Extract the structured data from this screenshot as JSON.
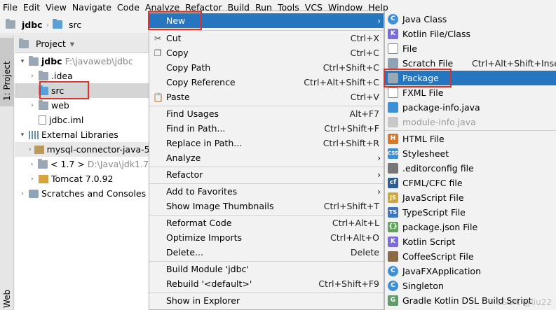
{
  "menubar": [
    "File",
    "Edit",
    "View",
    "Navigate",
    "Code",
    "Analyze",
    "Refactor",
    "Build",
    "Run",
    "Tools",
    "VCS",
    "Window",
    "Help"
  ],
  "breadcrumb": [
    "jdbc",
    "src"
  ],
  "stripe": {
    "project_tab": "1: Project",
    "web_tab": "Web"
  },
  "project_panel": {
    "title": "Project",
    "dropdown": "▾"
  },
  "tree": [
    {
      "arrow": "▾",
      "label": "jdbc",
      "hint": "F:\\javaweb\\jdbc"
    },
    {
      "arrow": "›",
      "label": ".idea"
    },
    {
      "arrow": "",
      "label": "src"
    },
    {
      "arrow": "›",
      "label": "web"
    },
    {
      "arrow": "",
      "label": "jdbc.iml"
    },
    {
      "arrow": "▾",
      "label": "External Libraries"
    },
    {
      "arrow": "›",
      "label": "mysql-connector-java-5"
    },
    {
      "arrow": "›",
      "label": "< 1.7 >",
      "hint": "D:\\Java\\jdk1.7"
    },
    {
      "arrow": "›",
      "label": "Tomcat 7.0.92"
    },
    {
      "arrow": "›",
      "label": "Scratches and Consoles"
    }
  ],
  "context_menu": {
    "new": "New",
    "cut": {
      "label": "Cut",
      "shortcut": "Ctrl+X"
    },
    "copy": {
      "label": "Copy",
      "shortcut": "Ctrl+C"
    },
    "copy_path": {
      "label": "Copy Path",
      "shortcut": "Ctrl+Shift+C"
    },
    "copy_reference": {
      "label": "Copy Reference",
      "shortcut": "Ctrl+Alt+Shift+C"
    },
    "paste": {
      "label": "Paste",
      "shortcut": "Ctrl+V"
    },
    "find_usages": {
      "label": "Find Usages",
      "shortcut": "Alt+F7"
    },
    "find_in_path": {
      "label": "Find in Path...",
      "shortcut": "Ctrl+Shift+F"
    },
    "replace_in_path": {
      "label": "Replace in Path...",
      "shortcut": "Ctrl+Shift+R"
    },
    "analyze": "Analyze",
    "refactor": "Refactor",
    "add_to_favorites": "Add to Favorites",
    "show_image_thumbnails": {
      "label": "Show Image Thumbnails",
      "shortcut": "Ctrl+Shift+T"
    },
    "reformat_code": {
      "label": "Reformat Code",
      "shortcut": "Ctrl+Alt+L"
    },
    "optimize_imports": {
      "label": "Optimize Imports",
      "shortcut": "Ctrl+Alt+O"
    },
    "delete": {
      "label": "Delete...",
      "shortcut": "Delete"
    },
    "build_module": "Build Module 'jdbc'",
    "rebuild": {
      "label": "Rebuild '<default>'",
      "shortcut": "Ctrl+Shift+F9"
    },
    "show_in_explorer": "Show in Explorer"
  },
  "submenu": [
    {
      "label": "Java Class",
      "icon": "C",
      "color": "#3d8fd8"
    },
    {
      "label": "Kotlin File/Class",
      "icon": "K",
      "color": "#7b6bdc"
    },
    {
      "label": "File",
      "icon": "",
      "color": "#ffffff"
    },
    {
      "label": "Scratch File",
      "shortcut": "Ctrl+Alt+Shift+Insert",
      "icon": "",
      "color": "#8fa3b6"
    },
    {
      "label": "Package",
      "icon": "",
      "color": "#9aa7b5"
    },
    {
      "label": "FXML File",
      "icon": "",
      "color": "#ffffff"
    },
    {
      "label": "package-info.java",
      "icon": "",
      "color": "#3d8fd8"
    },
    {
      "label": "module-info.java",
      "icon": "",
      "color": "#c8c8c8"
    },
    {
      "label": "HTML File",
      "icon": "H",
      "color": "#d8762a"
    },
    {
      "label": "Stylesheet",
      "icon": "CSS",
      "color": "#3d8fd8"
    },
    {
      "label": ".editorconfig file",
      "icon": "",
      "color": "#777777"
    },
    {
      "label": "CFML/CFC file",
      "icon": "cf",
      "color": "#2c5e96"
    },
    {
      "label": "JavaScript File",
      "icon": "JS",
      "color": "#d0a73a"
    },
    {
      "label": "TypeScript File",
      "icon": "TS",
      "color": "#3a77c0"
    },
    {
      "label": "package.json File",
      "icon": "{}",
      "color": "#5fa45b"
    },
    {
      "label": "Kotlin Script",
      "icon": "K",
      "color": "#7b6bdc"
    },
    {
      "label": "CoffeeScript File",
      "icon": "",
      "color": "#8b6a44"
    },
    {
      "label": "JavaFXApplication",
      "icon": "C",
      "color": "#3d8fd8"
    },
    {
      "label": "Singleton",
      "icon": "C",
      "color": "#3d8fd8"
    },
    {
      "label": "Gradle Kotlin DSL Build Script",
      "icon": "G",
      "color": "#5f9b6b"
    }
  ],
  "watermark": "CSDN @liu22"
}
